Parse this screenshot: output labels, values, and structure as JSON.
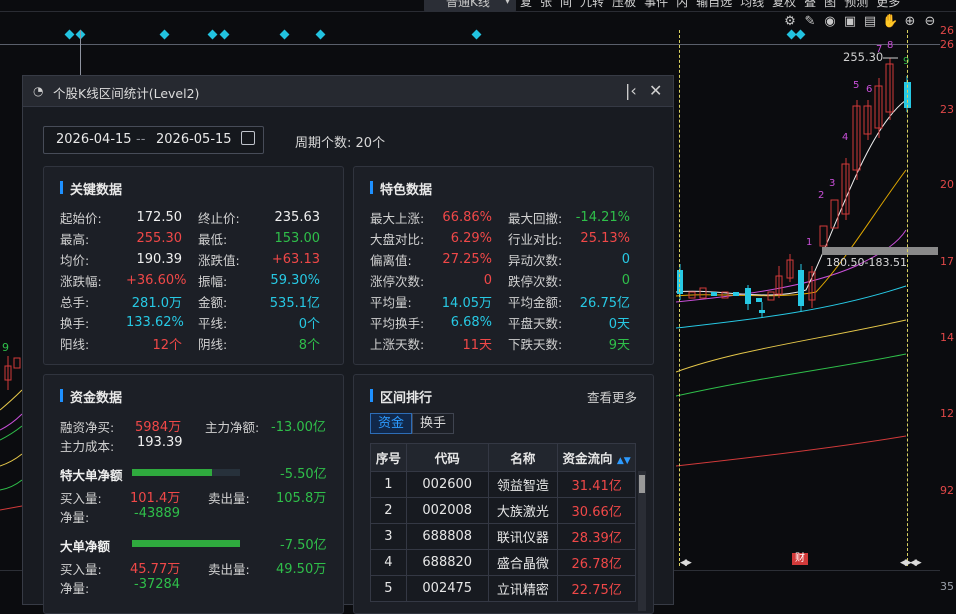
{
  "toolbar": {
    "kline_type": "普通K线",
    "menu": [
      "复",
      "张",
      "间",
      "九转",
      "压板",
      "事件",
      "内",
      "输自选",
      "均线",
      "复权",
      "叠",
      "图",
      "预测",
      "更多"
    ]
  },
  "price_axis": {
    "labels": [
      "26",
      "26",
      "23",
      "20",
      "17",
      "14",
      "12",
      "92",
      "35"
    ]
  },
  "chart": {
    "peak_label": "255.30",
    "range_label": "180.50-183.51",
    "badge": "财",
    "seq_numbers": [
      "1",
      "2",
      "3",
      "4",
      "5",
      "6",
      "7",
      "8",
      "9"
    ],
    "left_nine": "9"
  },
  "dialog": {
    "title": "个股K线区间统计(Level2)",
    "start_date": "2026-04-15",
    "separator": "--",
    "end_date": "2026-05-15",
    "period_label": "周期个数:",
    "period_value": "20个"
  },
  "key_data": {
    "title": "关键数据",
    "rows": [
      [
        {
          "label": "起始价:",
          "value": "172.50",
          "color": "white"
        },
        {
          "label": "终止价:",
          "value": "235.63",
          "color": "white"
        }
      ],
      [
        {
          "label": "最高:",
          "value": "255.30",
          "color": "red"
        },
        {
          "label": "最低:",
          "value": "153.00",
          "color": "green"
        }
      ],
      [
        {
          "label": "均价:",
          "value": "190.39",
          "color": "white"
        },
        {
          "label": "涨跌值:",
          "value": "+63.13",
          "color": "red"
        }
      ],
      [
        {
          "label": "涨跌幅:",
          "value": "+36.60%",
          "color": "red"
        },
        {
          "label": "振幅:",
          "value": "59.30%",
          "color": "cyan"
        }
      ],
      [
        {
          "label": "总手:",
          "value": "281.0万",
          "color": "cyan"
        },
        {
          "label": "金额:",
          "value": "535.1亿",
          "color": "cyan"
        }
      ],
      [
        {
          "label": "换手:",
          "value": "133.62%",
          "color": "cyan"
        },
        {
          "label": "平线:",
          "value": "0个",
          "color": "cyan"
        }
      ],
      [
        {
          "label": "阳线:",
          "value": "12个",
          "color": "red"
        },
        {
          "label": "阴线:",
          "value": "8个",
          "color": "green"
        }
      ]
    ]
  },
  "special_data": {
    "title": "特色数据",
    "rows": [
      [
        {
          "label": "最大上涨:",
          "value": "66.86%",
          "color": "red"
        },
        {
          "label": "最大回撤:",
          "value": "-14.21%",
          "color": "green"
        }
      ],
      [
        {
          "label": "大盘对比:",
          "value": "6.29%",
          "color": "red"
        },
        {
          "label": "行业对比:",
          "value": "25.13%",
          "color": "red"
        }
      ],
      [
        {
          "label": "偏离值:",
          "value": "27.25%",
          "color": "red"
        },
        {
          "label": "异动次数:",
          "value": "0",
          "color": "cyan"
        }
      ],
      [
        {
          "label": "涨停次数:",
          "value": "0",
          "color": "red"
        },
        {
          "label": "跌停次数:",
          "value": "0",
          "color": "green"
        }
      ],
      [
        {
          "label": "平均量:",
          "value": "14.05万",
          "color": "cyan"
        },
        {
          "label": "平均金额:",
          "value": "26.75亿",
          "color": "cyan"
        }
      ],
      [
        {
          "label": "平均换手:",
          "value": "6.68%",
          "color": "cyan"
        },
        {
          "label": "平盘天数:",
          "value": "0天",
          "color": "cyan"
        }
      ],
      [
        {
          "label": "上涨天数:",
          "value": "11天",
          "color": "red"
        },
        {
          "label": "下跌天数:",
          "value": "9天",
          "color": "green"
        }
      ]
    ]
  },
  "fund_data": {
    "title": "资金数据",
    "margin_label": "融资净买:",
    "margin_value": "5984万",
    "main_net_label": "主力净额:",
    "main_net_value": "-13.00亿",
    "main_cost_label": "主力成本:",
    "main_cost_value": "193.39",
    "super_label": "特大单净额",
    "super_value": "-5.50亿",
    "super_fill": 0.74,
    "super_buy_label": "买入量:",
    "super_buy_value": "101.4万",
    "super_sell_label": "卖出量:",
    "super_sell_value": "105.8万",
    "super_net_label": "净量:",
    "super_net_value": "-43889",
    "large_label": "大单净额",
    "large_value": "-7.50亿",
    "large_fill": 1.0,
    "large_buy_label": "买入量:",
    "large_buy_value": "45.77万",
    "large_sell_label": "卖出量:",
    "large_sell_value": "49.50万",
    "large_net_label": "净量:",
    "large_net_value": "-37284"
  },
  "ranking": {
    "title": "区间排行",
    "more": "查看更多",
    "tabs": [
      "资金",
      "换手"
    ],
    "headers": [
      "序号",
      "代码",
      "名称",
      "资金流向"
    ],
    "rows": [
      [
        "1",
        "002600",
        "领益智造",
        "31.41亿"
      ],
      [
        "2",
        "002008",
        "大族激光",
        "30.66亿"
      ],
      [
        "3",
        "688808",
        "联讯仪器",
        "28.39亿"
      ],
      [
        "4",
        "688820",
        "盛合晶微",
        "26.78亿"
      ],
      [
        "5",
        "002475",
        "立讯精密",
        "22.75亿"
      ]
    ]
  }
}
